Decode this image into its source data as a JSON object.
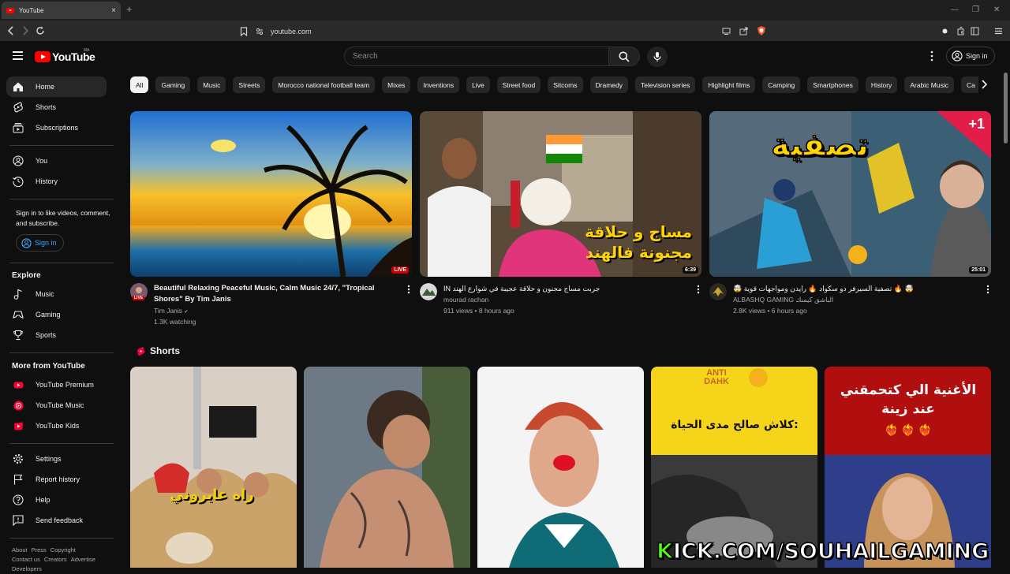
{
  "browser": {
    "tab_title": "YouTube",
    "tab_close": "×",
    "new_tab": "+",
    "url": "youtube.com",
    "win_min": "—",
    "win_max": "❐",
    "win_close": "✕"
  },
  "masthead": {
    "logo_text": "YouTube",
    "region": "MA",
    "search_placeholder": "Search",
    "signin_label": "Sign in"
  },
  "sidebar": {
    "main": [
      {
        "label": "Home",
        "icon": "home-icon",
        "active": true
      },
      {
        "label": "Shorts",
        "icon": "shorts-icon"
      },
      {
        "label": "Subscriptions",
        "icon": "subscriptions-icon"
      }
    ],
    "you": [
      {
        "label": "You",
        "icon": "you-icon"
      },
      {
        "label": "History",
        "icon": "history-icon"
      }
    ],
    "signin_prompt": "Sign in to like videos, comment, and subscribe.",
    "signin_label": "Sign in",
    "explore_heading": "Explore",
    "explore": [
      {
        "label": "Music",
        "icon": "music-icon"
      },
      {
        "label": "Gaming",
        "icon": "gaming-icon"
      },
      {
        "label": "Sports",
        "icon": "sports-icon"
      }
    ],
    "more_heading": "More from YouTube",
    "more": [
      {
        "label": "YouTube Premium",
        "icon": "youtube-premium-icon"
      },
      {
        "label": "YouTube Music",
        "icon": "youtube-music-icon"
      },
      {
        "label": "YouTube Kids",
        "icon": "youtube-kids-icon"
      }
    ],
    "settings": [
      {
        "label": "Settings",
        "icon": "gear-icon"
      },
      {
        "label": "Report history",
        "icon": "flag-icon"
      },
      {
        "label": "Help",
        "icon": "help-icon"
      },
      {
        "label": "Send feedback",
        "icon": "feedback-icon"
      }
    ],
    "footer": {
      "about": "About",
      "press": "Press",
      "copyright": "Copyright",
      "contact": "Contact us",
      "creators": "Creators",
      "advertise": "Advertise",
      "developers": "Developers"
    }
  },
  "chips": [
    "All",
    "Gaming",
    "Music",
    "Streets",
    "Morocco national football team",
    "Mixes",
    "Inventions",
    "Live",
    "Street food",
    "Sitcoms",
    "Dramedy",
    "Television series",
    "Highlight films",
    "Camping",
    "Smartphones",
    "History",
    "Arabic Music",
    "Ca"
  ],
  "videos": [
    {
      "title": "Beautiful Relaxing Peaceful Music, Calm Music 24/7, \"Tropical Shores\" By Tim Janis",
      "channel": "Tim Janis",
      "verified": "✔",
      "stats": "1.3K watching",
      "badge": "LIVE",
      "live_tag": "LIVE"
    },
    {
      "title": "IN جربت مساج مجنون و حلاقة عجيبة في شوارع الهند",
      "channel": "mourad rachan",
      "stats": "911 views • 8 hours ago",
      "badge": "6:39",
      "thumb_text_1": "مساج و حلاقة",
      "thumb_text_2": "مجنونة فالهند"
    },
    {
      "title": "🤯 تصفية السيرفر دو سكواد 🔥 رايدن ومواجهات قوية 🔥 🤯",
      "channel": "ALBASHQ GAMING الباشق كيمنك",
      "stats": "2.8K views • 6 hours ago",
      "badge": "25:01",
      "thumb_text": "تصفية",
      "thumb_corner": "+1"
    }
  ],
  "shorts": {
    "heading": "Shorts",
    "items": [
      {
        "caption": "راه عايروني"
      },
      {
        "caption": ""
      },
      {
        "caption": ""
      },
      {
        "caption_top": "ANTI DAHK",
        "caption": "كلاش صالح مدى الحياة:"
      },
      {
        "caption": "الأغنية الي كتحمقني عند زينة",
        "hearts": "❤️‍🔥 ❤️‍🔥 ❤️‍🔥"
      }
    ]
  },
  "watermark": {
    "first": "K",
    "rest": "ICK.COM/SOUHAILGAMING"
  }
}
